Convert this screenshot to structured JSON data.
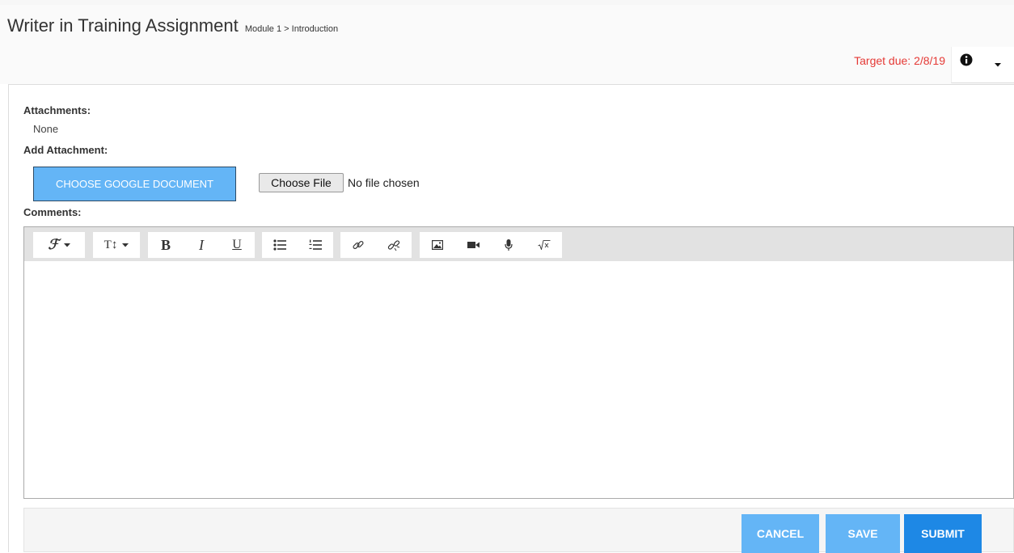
{
  "header": {
    "title": "Writer in Training Assignment",
    "breadcrumb": "Module 1 > Introduction",
    "target_due": "Target due: 2/8/19",
    "icons": [
      "info-icon",
      "caret-down-icon"
    ]
  },
  "attachments": {
    "label": "Attachments:",
    "value": "None",
    "add_label": "Add Attachment:",
    "google_button": "CHOOSE GOOGLE DOCUMENT",
    "file_button": "Choose File",
    "file_status": "No file chosen"
  },
  "comments": {
    "label": "Comments:",
    "toolbar": {
      "font_family": "ℱ",
      "font_size": "T↕",
      "bold": "B",
      "italic": "I",
      "underline": "U",
      "tools": [
        "font-family",
        "font-size",
        "bold",
        "italic",
        "underline",
        "bulleted-list",
        "numbered-list",
        "link",
        "unlink",
        "image",
        "video",
        "microphone",
        "math"
      ]
    },
    "value": ""
  },
  "footer": {
    "cancel": "CANCEL",
    "save": "SAVE",
    "submit": "SUBMIT"
  },
  "colors": {
    "accent": "#64b5f6",
    "primary": "#1e88e5",
    "due": "#e53935"
  }
}
